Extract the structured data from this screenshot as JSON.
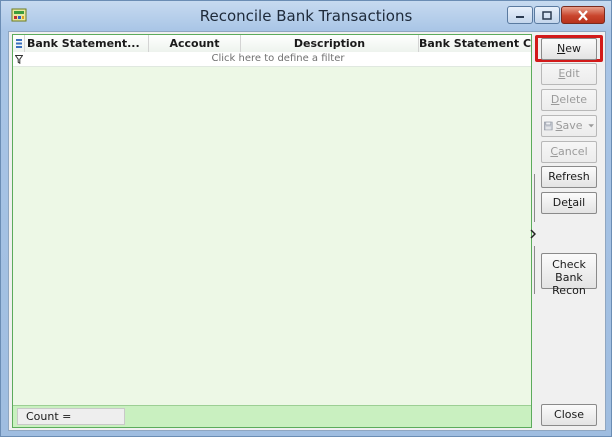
{
  "window": {
    "title": "Reconcile Bank Transactions",
    "accent_color": "#d21a1a",
    "grid_bg_color": "#edf8e6",
    "footer_color": "#c9f0c0"
  },
  "grid": {
    "columns": [
      {
        "label": "Bank Statement..."
      },
      {
        "label": "Account"
      },
      {
        "label": "Description"
      },
      {
        "label": "Bank Statement Clo..."
      }
    ],
    "filter_hint": "Click here to define a filter",
    "count_label": "Count ="
  },
  "buttons": {
    "new": {
      "pre": "",
      "u": "N",
      "post": "ew"
    },
    "edit": {
      "pre": "",
      "u": "E",
      "post": "dit"
    },
    "delete": {
      "pre": "",
      "u": "D",
      "post": "elete"
    },
    "save": {
      "pre": "",
      "u": "S",
      "post": "ave"
    },
    "cancel": {
      "pre": "",
      "u": "C",
      "post": "ancel"
    },
    "refresh": {
      "label": "Refresh"
    },
    "detail": {
      "pre": "De",
      "u": "t",
      "post": "ail"
    },
    "check_bank_recon": {
      "line1": "Check",
      "line2": "Bank Recon"
    },
    "close": {
      "label": "Close"
    }
  },
  "icons": {
    "app": "app-calculator-icon",
    "save": "floppy-disk-icon",
    "filter": "funnel-icon",
    "row_indicator": "row-indicator-icon"
  }
}
